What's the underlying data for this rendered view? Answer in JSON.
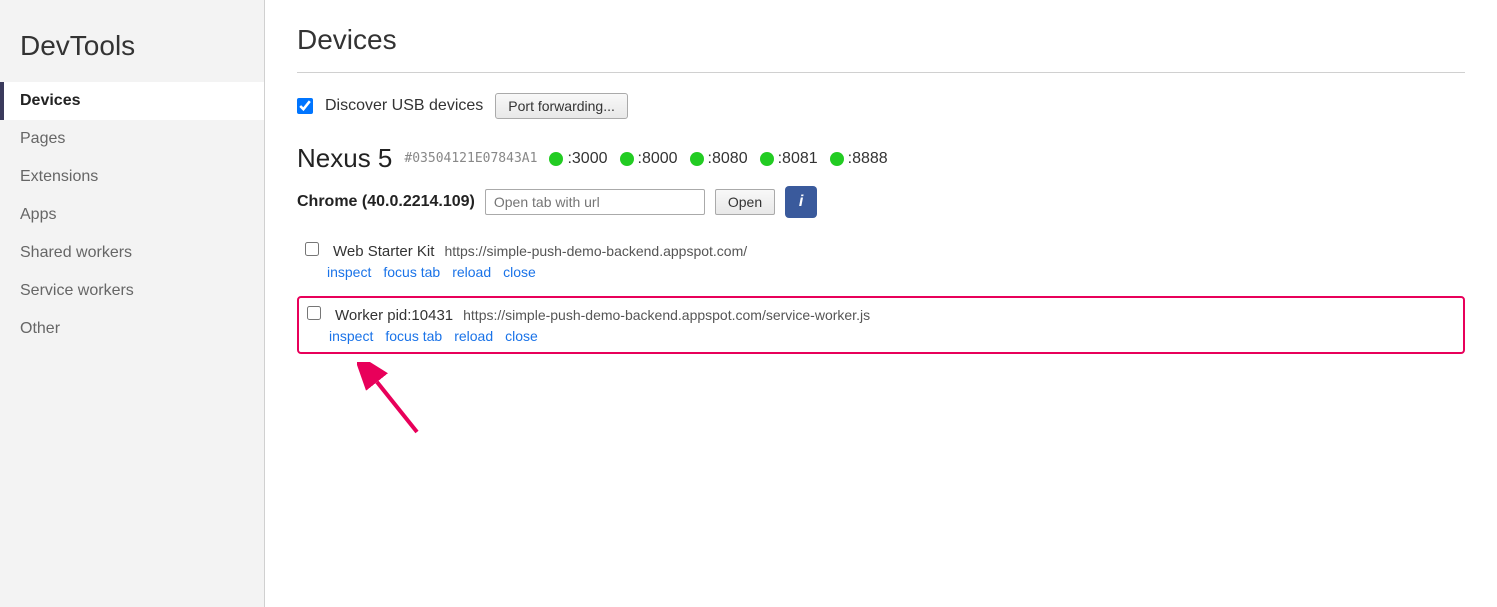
{
  "sidebar": {
    "title": "DevTools",
    "items": [
      {
        "id": "devices",
        "label": "Devices",
        "active": true
      },
      {
        "id": "pages",
        "label": "Pages",
        "active": false
      },
      {
        "id": "extensions",
        "label": "Extensions",
        "active": false
      },
      {
        "id": "apps",
        "label": "Apps",
        "active": false
      },
      {
        "id": "shared-workers",
        "label": "Shared workers",
        "active": false
      },
      {
        "id": "service-workers",
        "label": "Service workers",
        "active": false
      },
      {
        "id": "other",
        "label": "Other",
        "active": false
      }
    ]
  },
  "main": {
    "title": "Devices",
    "usb": {
      "label": "Discover USB devices",
      "checked": true
    },
    "port_forwarding_label": "Port forwarding...",
    "device": {
      "name": "Nexus 5",
      "id": "#03504121E07843A1",
      "ports": [
        ":3000",
        ":8000",
        ":8080",
        ":8081",
        ":8888"
      ]
    },
    "chrome": {
      "label": "Chrome (40.0.2214.109)",
      "url_placeholder": "Open tab with url",
      "open_label": "Open",
      "info_label": "i"
    },
    "tabs": [
      {
        "id": "tab1",
        "name": "Web Starter Kit",
        "url": "https://simple-push-demo-backend.appspot.com/",
        "highlighted": false,
        "actions": [
          "inspect",
          "focus tab",
          "reload",
          "close"
        ]
      },
      {
        "id": "tab2",
        "name": "Worker pid:10431",
        "url": "https://simple-push-demo-backend.appspot.com/service-worker.js",
        "highlighted": true,
        "actions": [
          "inspect",
          "focus tab",
          "reload",
          "close"
        ]
      }
    ]
  }
}
